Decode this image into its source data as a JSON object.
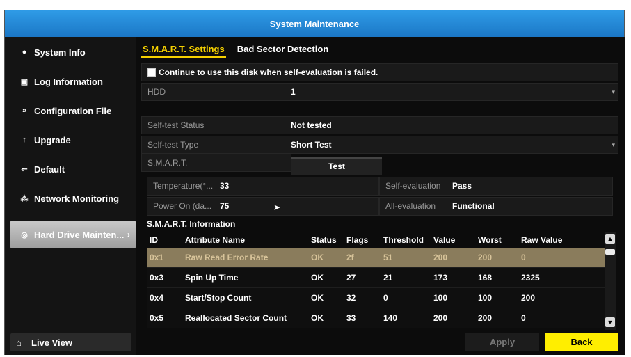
{
  "window": {
    "title": "System Maintenance"
  },
  "sidebar": {
    "items": [
      {
        "label": "System Info",
        "icon": "info-icon"
      },
      {
        "label": "Log Information",
        "icon": "log-icon"
      },
      {
        "label": "Configuration File",
        "icon": "config-file-icon"
      },
      {
        "label": "Upgrade",
        "icon": "upgrade-icon"
      },
      {
        "label": "Default",
        "icon": "default-icon"
      },
      {
        "label": "Network Monitoring",
        "icon": "network-icon"
      },
      {
        "label": "Hard Drive Mainten...",
        "icon": "hard-drive-icon",
        "active": true
      }
    ],
    "live_view": "Live View"
  },
  "tabs": [
    {
      "label": "S.M.A.R.T. Settings",
      "active": true
    },
    {
      "label": "Bad Sector Detection",
      "active": false
    }
  ],
  "settings": {
    "continue_checkbox_label": "Continue to use this disk when self-evaluation is failed.",
    "hdd_label": "HDD",
    "hdd_value": "1",
    "selftest_status_label": "Self-test Status",
    "selftest_status_value": "Not tested",
    "selftest_type_label": "Self-test Type",
    "selftest_type_value": "Short Test",
    "smart_label": "S.M.A.R.T.",
    "test_button": "Test",
    "temperature_label": "Temperature(°...",
    "temperature_value": "33",
    "power_on_label": "Power On (da...",
    "power_on_value": "75",
    "self_evaluation_label": "Self-evaluation",
    "self_evaluation_value": "Pass",
    "all_evaluation_label": "All-evaluation",
    "all_evaluation_value": "Functional"
  },
  "smart_info": {
    "title": "S.M.A.R.T. Information",
    "headers": [
      "ID",
      "Attribute Name",
      "Status",
      "Flags",
      "Threshold",
      "Value",
      "Worst",
      "Raw Value"
    ],
    "rows": [
      [
        "0x1",
        "Raw Read Error Rate",
        "OK",
        "2f",
        "51",
        "200",
        "200",
        "0"
      ],
      [
        "0x3",
        "Spin Up Time",
        "OK",
        "27",
        "21",
        "173",
        "168",
        "2325"
      ],
      [
        "0x4",
        "Start/Stop Count",
        "OK",
        "32",
        "0",
        "100",
        "100",
        "200"
      ],
      [
        "0x5",
        "Reallocated Sector Count",
        "OK",
        "33",
        "140",
        "200",
        "200",
        "0"
      ]
    ]
  },
  "buttons": {
    "apply": "Apply",
    "back": "Back"
  },
  "colors": {
    "accent_yellow": "#ffee00",
    "titlebar_blue": "#1b77c6",
    "selected_row": "#8a7c5c"
  }
}
